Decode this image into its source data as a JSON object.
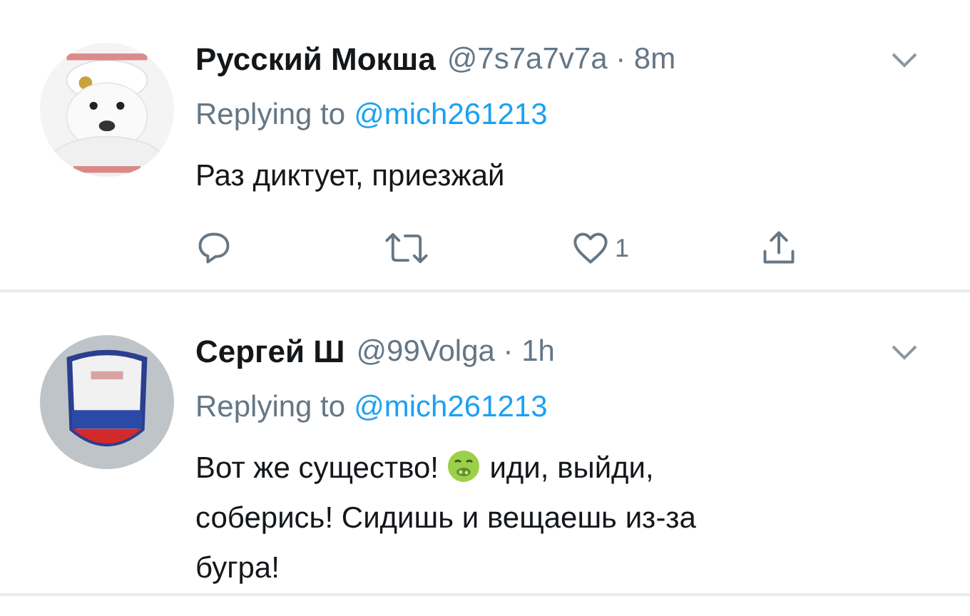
{
  "tweets": [
    {
      "avatar": {
        "kind": "picture"
      },
      "name": "Русский Мокша",
      "meta": "@7s7a7v7a · 8m",
      "reply_prefix": "Replying to",
      "mention": "@mich261213",
      "text": [
        {
          "kind": "text",
          "text": "Раз диктует, приезжай"
        }
      ],
      "actions": [
        {
          "kind": "reply"
        },
        {
          "kind": "retweet"
        },
        {
          "kind": "like",
          "count": "1"
        },
        {
          "kind": "share"
        }
      ]
    },
    {
      "avatar": {
        "kind": "picture"
      },
      "name": "Сергей Ш",
      "meta": "@99Volga · 1h",
      "reply_prefix": "Replying to",
      "mention": "@mich261213",
      "text": [
        {
          "kind": "text",
          "text": "Вот же существо! "
        },
        {
          "kind": "emoji"
        },
        {
          "kind": "text",
          "text": " иди, выйди, соберись! Сидишь и вещаешь из-за бугра!"
        }
      ]
    }
  ]
}
